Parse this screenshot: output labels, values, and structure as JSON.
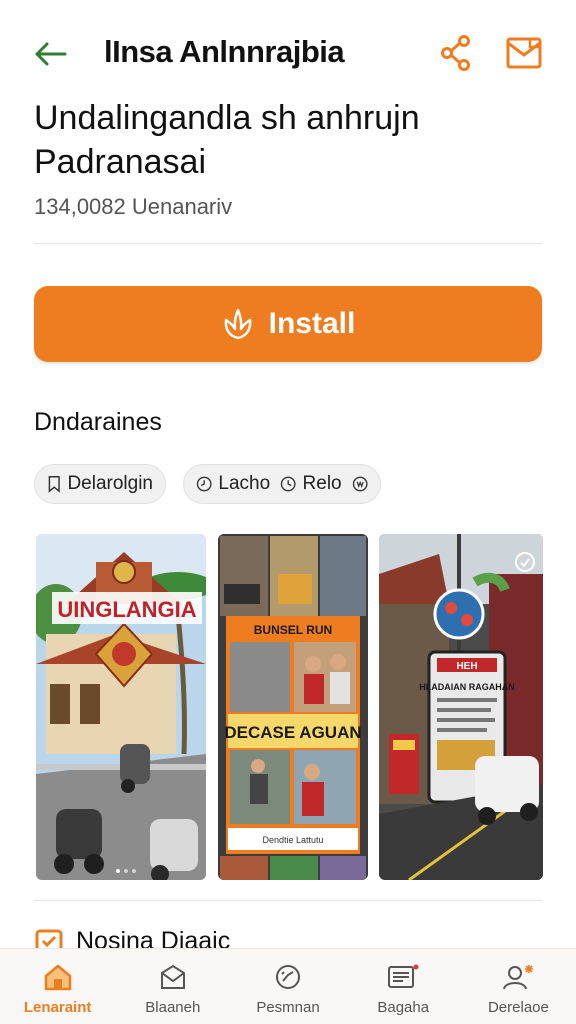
{
  "header": {
    "title": "lInsa Anlnnrajbia",
    "back_icon": "arrow-left-icon",
    "share_icon": "share-icon",
    "mail_icon": "mail-icon",
    "accent": "#ee7d21",
    "back_color": "#2e7d32"
  },
  "app": {
    "title": "Undalingandla sh anhrujn Padranasai",
    "meta": "134,0082 Uenanariv"
  },
  "install": {
    "label": "Install",
    "icon": "leaf-icon"
  },
  "section": {
    "title": "Dndaraines",
    "chips": [
      {
        "label": "Delarolgin",
        "icon": "bookmark-icon"
      },
      {
        "label": "Lacho",
        "icon": "clock-icon"
      },
      {
        "label": "Relo",
        "icon": "shield-icon"
      }
    ]
  },
  "screenshots": [
    {
      "banner": "UINGLANGIA"
    },
    {
      "header": "BUNSEL RUN",
      "banner": "DECASE AGUAN",
      "footer": "Dendtie Lattutu"
    },
    {
      "sign_top": "HEH",
      "sign_title": "HLADAIAN RAGAHAN"
    }
  ],
  "section2": {
    "title": "Nosina Diaaic",
    "icon": "calendar-icon"
  },
  "bottom_nav": [
    {
      "label": "Lenaraint",
      "icon": "home-icon",
      "active": true
    },
    {
      "label": "Blaaneh",
      "icon": "envelope-icon",
      "active": false
    },
    {
      "label": "Pesmnan",
      "icon": "gauge-icon",
      "active": false
    },
    {
      "label": "Bagaha",
      "icon": "list-icon",
      "active": false
    },
    {
      "label": "Derelaoe",
      "icon": "user-icon",
      "active": false
    }
  ]
}
